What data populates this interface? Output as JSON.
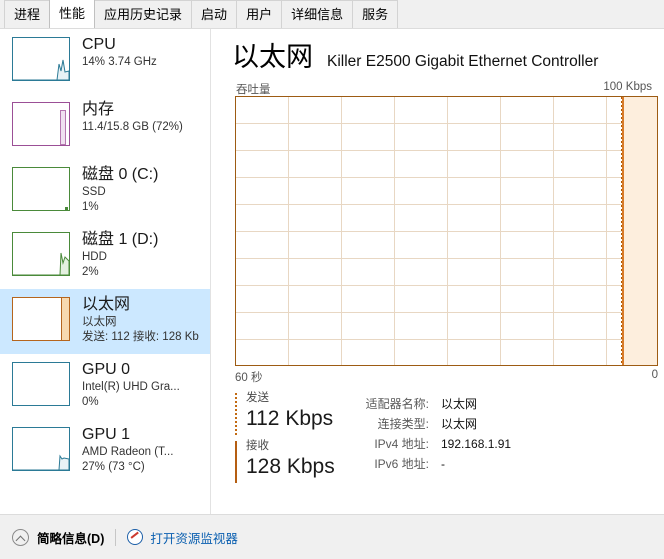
{
  "tabs": [
    {
      "label": "进程",
      "active": false
    },
    {
      "label": "性能",
      "active": true
    },
    {
      "label": "应用历史记录",
      "active": false
    },
    {
      "label": "启动",
      "active": false
    },
    {
      "label": "用户",
      "active": false
    },
    {
      "label": "详细信息",
      "active": false
    },
    {
      "label": "服务",
      "active": false
    }
  ],
  "sidebar": {
    "items": [
      {
        "title": "CPU",
        "sub1": "14% 3.74 GHz",
        "sub2": "",
        "color": "#2b7a96",
        "selected": false
      },
      {
        "title": "内存",
        "sub1": "11.4/15.8 GB (72%)",
        "sub2": "",
        "color": "#9b4f96",
        "selected": false
      },
      {
        "title": "磁盘 0 (C:)",
        "sub1": "SSD",
        "sub2": "1%",
        "color": "#4a8a3a",
        "selected": false
      },
      {
        "title": "磁盘 1 (D:)",
        "sub1": "HDD",
        "sub2": "2%",
        "color": "#4a8a3a",
        "selected": false
      },
      {
        "title": "以太网",
        "sub1": "以太网",
        "sub2": "发送: 112 接收: 128 Kb",
        "color": "#b5651d",
        "selected": true
      },
      {
        "title": "GPU 0",
        "sub1": "Intel(R) UHD Gra...",
        "sub2": "0%",
        "color": "#2b7a96",
        "selected": false
      },
      {
        "title": "GPU 1",
        "sub1": "AMD Radeon (T...",
        "sub2": "27% (73 °C)",
        "color": "#2b7a96",
        "selected": false
      }
    ]
  },
  "main": {
    "title": "以太网",
    "subtitle": "Killer E2500 Gigabit Ethernet Controller",
    "chart_caption_left": "吞吐量",
    "chart_caption_right": "100 Kbps",
    "axis_left": "60 秒",
    "axis_right": "0",
    "send": {
      "label": "发送",
      "value": "112 Kbps"
    },
    "recv": {
      "label": "接收",
      "value": "128 Kbps"
    },
    "info": [
      {
        "key": "适配器名称:",
        "value": "以太网"
      },
      {
        "key": "连接类型:",
        "value": "以太网"
      },
      {
        "key": "IPv4 地址:",
        "value": "192.168.1.91"
      },
      {
        "key": "IPv6 地址:",
        "value": "-"
      }
    ]
  },
  "chart_data": {
    "type": "area",
    "title": "吞吐量",
    "xlabel": "",
    "ylabel": "Kbps",
    "ylim": [
      0,
      100
    ],
    "xlim": [
      60,
      0
    ],
    "x_tick_labels": [
      "60 秒",
      "0"
    ],
    "y_tick_labels": [
      "100 Kbps"
    ],
    "grid": true,
    "grid_cols": 8,
    "grid_rows": 10,
    "legend_position": "below-left",
    "series": [
      {
        "name": "发送",
        "style": "dotted",
        "color": "#b35a00",
        "current_value": 112,
        "unit": "Kbps"
      },
      {
        "name": "接收",
        "style": "solid",
        "color": "#d77b2a",
        "current_value": 128,
        "unit": "Kbps"
      }
    ],
    "annotations": [
      {
        "text": "100 Kbps",
        "position": "top-right"
      },
      {
        "text": "60 秒",
        "position": "bottom-left"
      },
      {
        "text": "0",
        "position": "bottom-right"
      }
    ],
    "note": "Traffic data only present in the newest ~9% of the 60-second window (right edge); fill region spans x=60s..0s at the right."
  },
  "bottombar": {
    "summary_label": "简略信息(D)",
    "resource_monitor_label": "打开资源监视器"
  },
  "colors": {
    "selection": "#cce8ff",
    "ethernet_accent": "#b5651d",
    "chart_border": "#9d5b13",
    "chart_grid": "#e8d7c3",
    "chart_fill": "#fdeedd",
    "link": "#0a5fb0"
  }
}
